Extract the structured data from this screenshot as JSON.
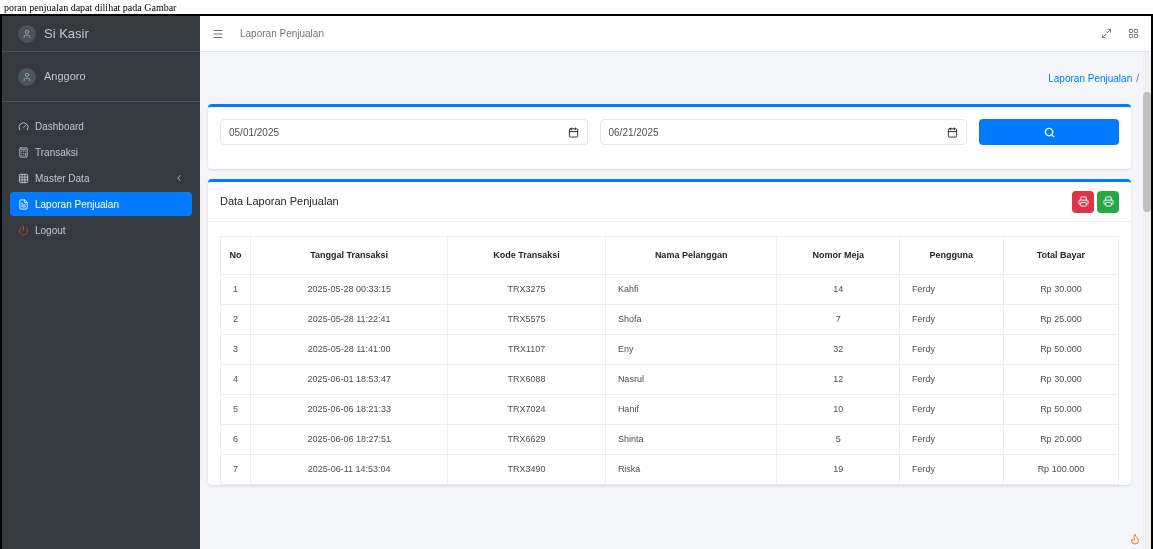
{
  "caption": "poran penjualan dapat dilihat pada Gambar",
  "sidebar": {
    "brand": "Si Kasir",
    "user": "Anggoro",
    "items": [
      {
        "label": "Dashboard",
        "kind": "dashboard",
        "selected": false,
        "expandable": false
      },
      {
        "label": "Transaksi",
        "kind": "register",
        "selected": false,
        "expandable": false
      },
      {
        "label": "Master Data",
        "kind": "grid",
        "selected": false,
        "expandable": true
      },
      {
        "label": "Laporan Penjualan",
        "kind": "file",
        "selected": true,
        "expandable": false
      },
      {
        "label": "Logout",
        "kind": "power",
        "selected": false,
        "expandable": false
      }
    ]
  },
  "navbar": {
    "title": "Laporan Penjualan"
  },
  "breadcrumb": [
    {
      "label": "Laporan Penjualan",
      "separator": "/"
    }
  ],
  "filter": {
    "start_date": "05/01/2025",
    "end_date": "06/21/2025"
  },
  "report": {
    "title": "Data Laporan Penjualan",
    "columns": [
      "No",
      "Tanggal Transaksi",
      "Kode Transaksi",
      "Nama Pelanggan",
      "Nomor Meja",
      "Pengguna",
      "Total Bayar"
    ],
    "rows": [
      [
        "1",
        "2025-05-28 00:33:15",
        "TRX3275",
        "Kahfi",
        "14",
        "Ferdy",
        "Rp 30.000"
      ],
      [
        "2",
        "2025-05-28 11:22:41",
        "TRX5575",
        "Shofa",
        "7",
        "Ferdy",
        "Rp 25.000"
      ],
      [
        "3",
        "2025-05-28 11:41:00",
        "TRX1107",
        "Eny",
        "32",
        "Ferdy",
        "Rp 50.000"
      ],
      [
        "4",
        "2025-06-01 18:53:47",
        "TRX6088",
        "Nasrul",
        "12",
        "Ferdy",
        "Rp 30.000"
      ],
      [
        "5",
        "2025-06-06 18:21:33",
        "TRX7024",
        "Hanif",
        "10",
        "Ferdy",
        "Rp 50.000"
      ],
      [
        "6",
        "2025-06-06 18:27:51",
        "TRX6629",
        "Shinta",
        "5",
        "Ferdy",
        "Rp 20.000"
      ],
      [
        "7",
        "2025-06-11 14:53:04",
        "TRX3490",
        "Riska",
        "19",
        "Ferdy",
        "Rp 100.000"
      ]
    ]
  }
}
